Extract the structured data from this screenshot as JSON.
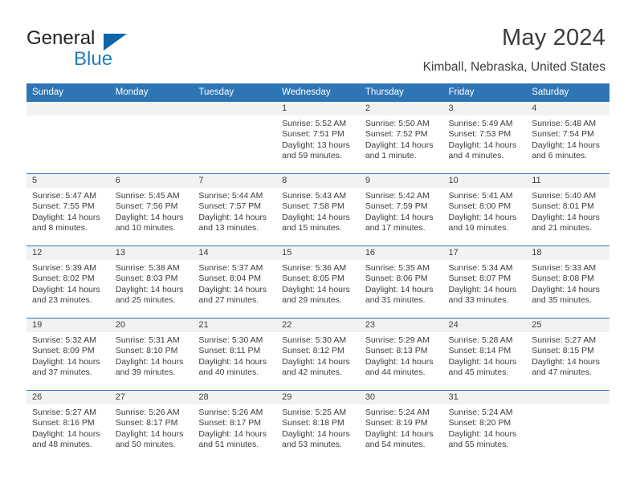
{
  "brand": {
    "word1": "General",
    "word2": "Blue",
    "triangle_color": "#1064a8",
    "word2_color": "#1f7ec4"
  },
  "header": {
    "title": "May 2024",
    "subtitle": "Kimball, Nebraska, United States",
    "header_bg": "#2e75b6",
    "daynum_bg": "#f2f2f2"
  },
  "weekday_headers": [
    "Sunday",
    "Monday",
    "Tuesday",
    "Wednesday",
    "Thursday",
    "Friday",
    "Saturday"
  ],
  "labels": {
    "sunrise": "Sunrise:",
    "sunset": "Sunset:",
    "daylight": "Daylight:"
  },
  "weeks": [
    [
      {
        "day": "",
        "empty": true
      },
      {
        "day": "",
        "empty": true
      },
      {
        "day": "",
        "empty": true
      },
      {
        "day": "1",
        "sunrise": "Sunrise: 5:52 AM",
        "sunset": "Sunset: 7:51 PM",
        "daylight_line1": "Daylight: 13 hours",
        "daylight_line2": "and 59 minutes."
      },
      {
        "day": "2",
        "sunrise": "Sunrise: 5:50 AM",
        "sunset": "Sunset: 7:52 PM",
        "daylight_line1": "Daylight: 14 hours",
        "daylight_line2": "and 1 minute."
      },
      {
        "day": "3",
        "sunrise": "Sunrise: 5:49 AM",
        "sunset": "Sunset: 7:53 PM",
        "daylight_line1": "Daylight: 14 hours",
        "daylight_line2": "and 4 minutes."
      },
      {
        "day": "4",
        "sunrise": "Sunrise: 5:48 AM",
        "sunset": "Sunset: 7:54 PM",
        "daylight_line1": "Daylight: 14 hours",
        "daylight_line2": "and 6 minutes."
      }
    ],
    [
      {
        "day": "5",
        "sunrise": "Sunrise: 5:47 AM",
        "sunset": "Sunset: 7:55 PM",
        "daylight_line1": "Daylight: 14 hours",
        "daylight_line2": "and 8 minutes."
      },
      {
        "day": "6",
        "sunrise": "Sunrise: 5:45 AM",
        "sunset": "Sunset: 7:56 PM",
        "daylight_line1": "Daylight: 14 hours",
        "daylight_line2": "and 10 minutes."
      },
      {
        "day": "7",
        "sunrise": "Sunrise: 5:44 AM",
        "sunset": "Sunset: 7:57 PM",
        "daylight_line1": "Daylight: 14 hours",
        "daylight_line2": "and 13 minutes."
      },
      {
        "day": "8",
        "sunrise": "Sunrise: 5:43 AM",
        "sunset": "Sunset: 7:58 PM",
        "daylight_line1": "Daylight: 14 hours",
        "daylight_line2": "and 15 minutes."
      },
      {
        "day": "9",
        "sunrise": "Sunrise: 5:42 AM",
        "sunset": "Sunset: 7:59 PM",
        "daylight_line1": "Daylight: 14 hours",
        "daylight_line2": "and 17 minutes."
      },
      {
        "day": "10",
        "sunrise": "Sunrise: 5:41 AM",
        "sunset": "Sunset: 8:00 PM",
        "daylight_line1": "Daylight: 14 hours",
        "daylight_line2": "and 19 minutes."
      },
      {
        "day": "11",
        "sunrise": "Sunrise: 5:40 AM",
        "sunset": "Sunset: 8:01 PM",
        "daylight_line1": "Daylight: 14 hours",
        "daylight_line2": "and 21 minutes."
      }
    ],
    [
      {
        "day": "12",
        "sunrise": "Sunrise: 5:39 AM",
        "sunset": "Sunset: 8:02 PM",
        "daylight_line1": "Daylight: 14 hours",
        "daylight_line2": "and 23 minutes."
      },
      {
        "day": "13",
        "sunrise": "Sunrise: 5:38 AM",
        "sunset": "Sunset: 8:03 PM",
        "daylight_line1": "Daylight: 14 hours",
        "daylight_line2": "and 25 minutes."
      },
      {
        "day": "14",
        "sunrise": "Sunrise: 5:37 AM",
        "sunset": "Sunset: 8:04 PM",
        "daylight_line1": "Daylight: 14 hours",
        "daylight_line2": "and 27 minutes."
      },
      {
        "day": "15",
        "sunrise": "Sunrise: 5:36 AM",
        "sunset": "Sunset: 8:05 PM",
        "daylight_line1": "Daylight: 14 hours",
        "daylight_line2": "and 29 minutes."
      },
      {
        "day": "16",
        "sunrise": "Sunrise: 5:35 AM",
        "sunset": "Sunset: 8:06 PM",
        "daylight_line1": "Daylight: 14 hours",
        "daylight_line2": "and 31 minutes."
      },
      {
        "day": "17",
        "sunrise": "Sunrise: 5:34 AM",
        "sunset": "Sunset: 8:07 PM",
        "daylight_line1": "Daylight: 14 hours",
        "daylight_line2": "and 33 minutes."
      },
      {
        "day": "18",
        "sunrise": "Sunrise: 5:33 AM",
        "sunset": "Sunset: 8:08 PM",
        "daylight_line1": "Daylight: 14 hours",
        "daylight_line2": "and 35 minutes."
      }
    ],
    [
      {
        "day": "19",
        "sunrise": "Sunrise: 5:32 AM",
        "sunset": "Sunset: 8:09 PM",
        "daylight_line1": "Daylight: 14 hours",
        "daylight_line2": "and 37 minutes."
      },
      {
        "day": "20",
        "sunrise": "Sunrise: 5:31 AM",
        "sunset": "Sunset: 8:10 PM",
        "daylight_line1": "Daylight: 14 hours",
        "daylight_line2": "and 39 minutes."
      },
      {
        "day": "21",
        "sunrise": "Sunrise: 5:30 AM",
        "sunset": "Sunset: 8:11 PM",
        "daylight_line1": "Daylight: 14 hours",
        "daylight_line2": "and 40 minutes."
      },
      {
        "day": "22",
        "sunrise": "Sunrise: 5:30 AM",
        "sunset": "Sunset: 8:12 PM",
        "daylight_line1": "Daylight: 14 hours",
        "daylight_line2": "and 42 minutes."
      },
      {
        "day": "23",
        "sunrise": "Sunrise: 5:29 AM",
        "sunset": "Sunset: 8:13 PM",
        "daylight_line1": "Daylight: 14 hours",
        "daylight_line2": "and 44 minutes."
      },
      {
        "day": "24",
        "sunrise": "Sunrise: 5:28 AM",
        "sunset": "Sunset: 8:14 PM",
        "daylight_line1": "Daylight: 14 hours",
        "daylight_line2": "and 45 minutes."
      },
      {
        "day": "25",
        "sunrise": "Sunrise: 5:27 AM",
        "sunset": "Sunset: 8:15 PM",
        "daylight_line1": "Daylight: 14 hours",
        "daylight_line2": "and 47 minutes."
      }
    ],
    [
      {
        "day": "26",
        "sunrise": "Sunrise: 5:27 AM",
        "sunset": "Sunset: 8:16 PM",
        "daylight_line1": "Daylight: 14 hours",
        "daylight_line2": "and 48 minutes."
      },
      {
        "day": "27",
        "sunrise": "Sunrise: 5:26 AM",
        "sunset": "Sunset: 8:17 PM",
        "daylight_line1": "Daylight: 14 hours",
        "daylight_line2": "and 50 minutes."
      },
      {
        "day": "28",
        "sunrise": "Sunrise: 5:26 AM",
        "sunset": "Sunset: 8:17 PM",
        "daylight_line1": "Daylight: 14 hours",
        "daylight_line2": "and 51 minutes."
      },
      {
        "day": "29",
        "sunrise": "Sunrise: 5:25 AM",
        "sunset": "Sunset: 8:18 PM",
        "daylight_line1": "Daylight: 14 hours",
        "daylight_line2": "and 53 minutes."
      },
      {
        "day": "30",
        "sunrise": "Sunrise: 5:24 AM",
        "sunset": "Sunset: 8:19 PM",
        "daylight_line1": "Daylight: 14 hours",
        "daylight_line2": "and 54 minutes."
      },
      {
        "day": "31",
        "sunrise": "Sunrise: 5:24 AM",
        "sunset": "Sunset: 8:20 PM",
        "daylight_line1": "Daylight: 14 hours",
        "daylight_line2": "and 55 minutes."
      },
      {
        "day": "",
        "empty": true
      }
    ]
  ]
}
